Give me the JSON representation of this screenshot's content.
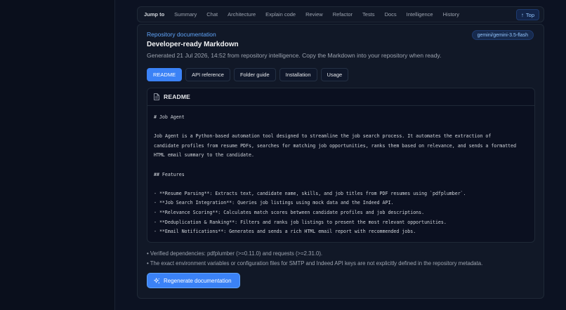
{
  "jump_nav": {
    "label": "Jump to",
    "links": [
      "Summary",
      "Chat",
      "Architecture",
      "Explain code",
      "Review",
      "Refactor",
      "Tests",
      "Docs",
      "Intelligence",
      "History"
    ],
    "top_button": "Top"
  },
  "card": {
    "eyebrow": "Repository documentation",
    "title": "Developer-ready Markdown",
    "subtitle": "Generated 21 Jul 2026, 14:52 from repository intelligence. Copy the Markdown into your repository when ready.",
    "model_badge": "gemini/gemini-3.5-flash"
  },
  "tabs": [
    {
      "label": "README",
      "active": true
    },
    {
      "label": "API reference",
      "active": false
    },
    {
      "label": "Folder guide",
      "active": false
    },
    {
      "label": "Installation",
      "active": false
    },
    {
      "label": "Usage",
      "active": false
    }
  ],
  "doc": {
    "header": "README",
    "lines": [
      "# Job Agent",
      "",
      "Job Agent is a Python-based automation tool designed to streamline the job search process. It automates the extraction of",
      "candidate profiles from resume PDFs, searches for matching job opportunities, ranks them based on relevance, and sends a formatted",
      "HTML email summary to the candidate.",
      "",
      "## Features",
      "",
      "- **Resume Parsing**: Extracts text, candidate name, skills, and job titles from PDF resumes using `pdfplumber`.",
      "- **Job Search Integration**: Queries job listings using mock data and the Indeed API.",
      "- **Relevance Scoring**: Calculates match scores between candidate profiles and job descriptions.",
      "- **Deduplication & Ranking**: Filters and ranks job listings to present the most relevant opportunities.",
      "- **Email Notifications**: Generates and sends a rich HTML email report with recommended jobs."
    ]
  },
  "notes": [
    "• Verified dependencies: pdfplumber (>=0.11.0) and requests (>=2.31.0).",
    "• The exact environment variables or configuration files for SMTP and Indeed API keys are not explicitly defined in the repository metadata."
  ],
  "regenerate_button": "Regenerate documentation",
  "icons": {
    "top": "arrow-up-icon",
    "doc_header": "file-text-icon",
    "regenerate": "sparkles-icon"
  },
  "colors": {
    "accent": "#3b82f6",
    "accent_text": "#60a5fa",
    "background": "#0b1120",
    "card": "#111827"
  }
}
